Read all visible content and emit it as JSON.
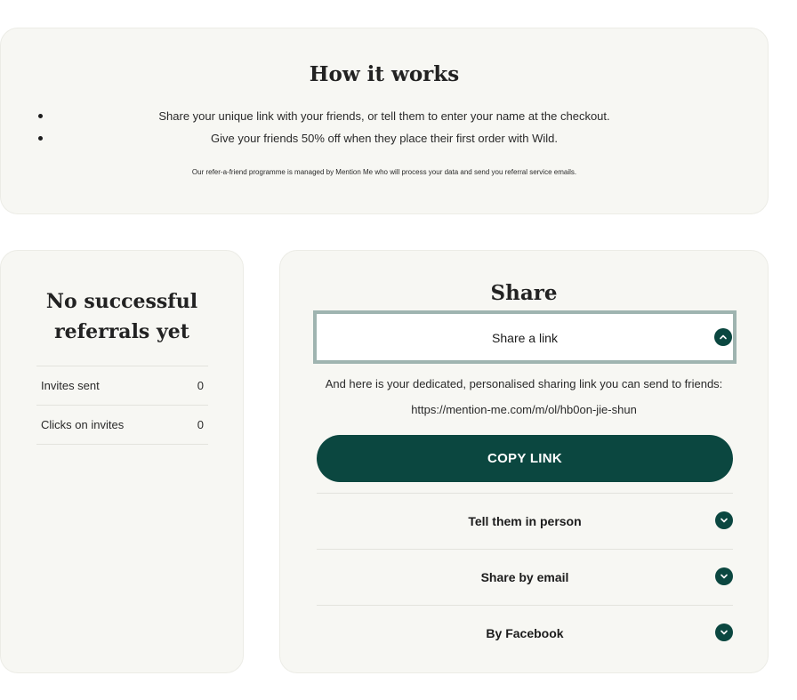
{
  "how_it_works": {
    "title": "How it works",
    "steps": [
      "Share your unique link with your friends, or tell them to enter your name at the checkout.",
      "Give your friends 50% off when they place their first order with Wild."
    ],
    "note": "Our refer-a-friend programme is managed by Mention Me who will process your data and send you referral service emails."
  },
  "stats": {
    "title": "No successful referrals yet",
    "rows": [
      {
        "label": "Invites sent",
        "value": "0"
      },
      {
        "label": "Clicks on invites",
        "value": "0"
      }
    ]
  },
  "share": {
    "title": "Share",
    "open_section": {
      "label": "Share a link",
      "icon": "chevron-up-icon",
      "description": "And here is your dedicated, personalised sharing link you can send to friends:",
      "link": "https://mention-me.com/m/ol/hb0on-jie-shun",
      "copy_button": "COPY LINK"
    },
    "sections": [
      {
        "label": "Tell them in person",
        "icon": "chevron-down-icon"
      },
      {
        "label": "Share by email",
        "icon": "chevron-down-icon"
      },
      {
        "label": "By Facebook",
        "icon": "chevron-down-icon"
      }
    ]
  },
  "colors": {
    "card_background": "#f7f7f3",
    "accent": "#0b4740",
    "focus_outline": "#9fb4b0"
  }
}
